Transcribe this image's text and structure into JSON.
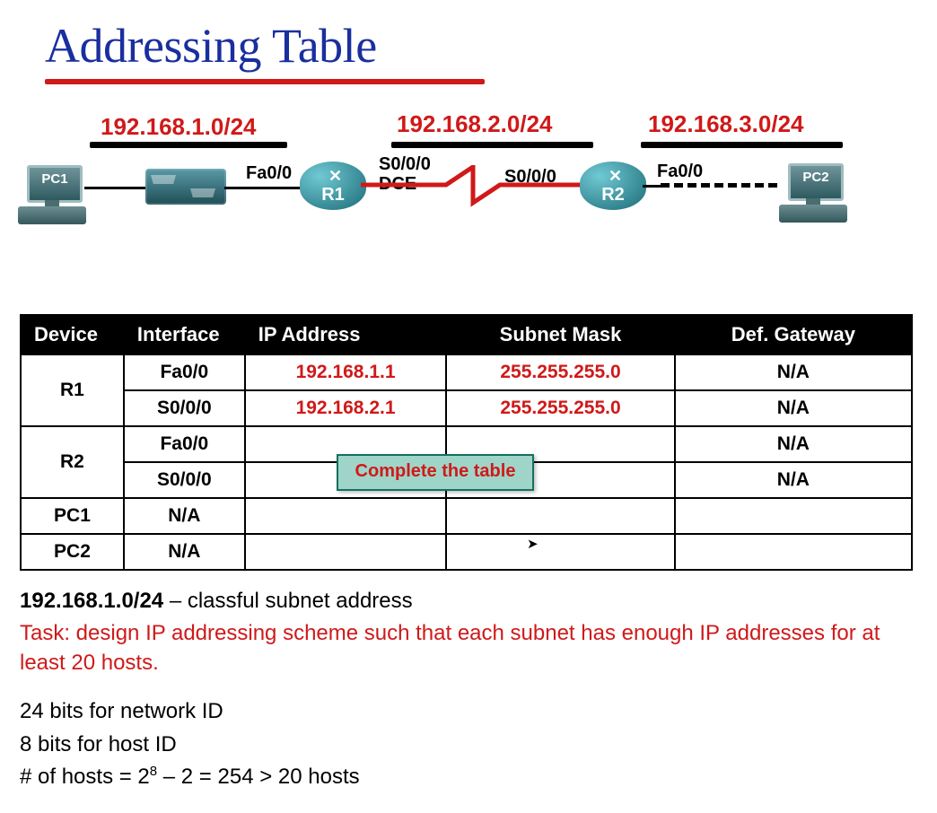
{
  "title": "Addressing Table",
  "topology": {
    "networks": [
      {
        "label": "192.168.1.0/24"
      },
      {
        "label": "192.168.2.0/24"
      },
      {
        "label": "192.168.3.0/24"
      }
    ],
    "pc1": "PC1",
    "pc2": "PC2",
    "r1": {
      "name": "R1",
      "fa": "Fa0/0",
      "s0": "S0/0/0",
      "dce": "DCE"
    },
    "r2": {
      "name": "R2",
      "fa": "Fa0/0",
      "s0": "S0/0/0"
    }
  },
  "table": {
    "headers": [
      "Device",
      "Interface",
      "IP Address",
      "Subnet Mask",
      "Def. Gateway"
    ],
    "rows": [
      {
        "device": "R1",
        "rowspan": 2,
        "iface": "Fa0/0",
        "ip": "192.168.1.1",
        "mask": "255.255.255.0",
        "gw": "N/A"
      },
      {
        "device": "",
        "iface": "S0/0/0",
        "ip": "192.168.2.1",
        "mask": "255.255.255.0",
        "gw": "N/A"
      },
      {
        "device": "R2",
        "rowspan": 2,
        "iface": "Fa0/0",
        "ip": "",
        "mask": "",
        "gw": "N/A"
      },
      {
        "device": "",
        "iface": "S0/0/0",
        "ip": "",
        "mask": "",
        "gw": "N/A"
      },
      {
        "device": "PC1",
        "rowspan": 1,
        "iface": "N/A",
        "ip": "",
        "mask": "",
        "gw": ""
      },
      {
        "device": "PC2",
        "rowspan": 1,
        "iface": "N/A",
        "ip": "",
        "mask": "",
        "gw": ""
      }
    ],
    "callout": "Complete the table"
  },
  "notes": {
    "line1_bold": "192.168.1.0/24",
    "line1_rest": "   –   classful subnet address",
    "task": "Task: design IP addressing scheme such that each subnet has enough IP addresses for at least 20 hosts.",
    "line3": "24 bits for network ID",
    "line4": "8 bits for host ID",
    "line5_pre": "# of hosts = 2",
    "line5_sup": "8",
    "line5_post": " – 2 = 254 > 20 hosts"
  }
}
